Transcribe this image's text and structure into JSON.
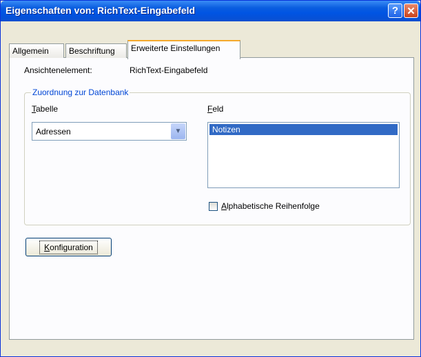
{
  "window": {
    "title": "Eigenschaften von: RichText-Eingabefeld",
    "help_icon": "help-icon",
    "close_icon": "close-icon"
  },
  "tabs": [
    {
      "label": "Allgemein",
      "active": false
    },
    {
      "label": "Beschriftung",
      "active": false
    },
    {
      "label": "Erweiterte Einstellungen",
      "active": true
    }
  ],
  "view_element": {
    "label": "Ansichtenelement:",
    "value": "RichText-Eingabefeld"
  },
  "group": {
    "title": "Zuordnung zur Datenbank",
    "table_label_underlined": "T",
    "table_label_rest": "abelle",
    "table_selected": "Adressen",
    "field_label_underlined": "F",
    "field_label_rest": "eld",
    "field_items": [
      "Notizen"
    ],
    "checkbox_underlined": "A",
    "checkbox_rest": "lphabetische Reihenfolge",
    "checkbox_checked": false
  },
  "config_button": {
    "underlined": "K",
    "rest": "onfiguration"
  },
  "colors": {
    "titlebar": "#0054e3",
    "selection": "#316ac5",
    "group_title": "#0046d5",
    "active_tab_accent": "#f5a92b"
  }
}
